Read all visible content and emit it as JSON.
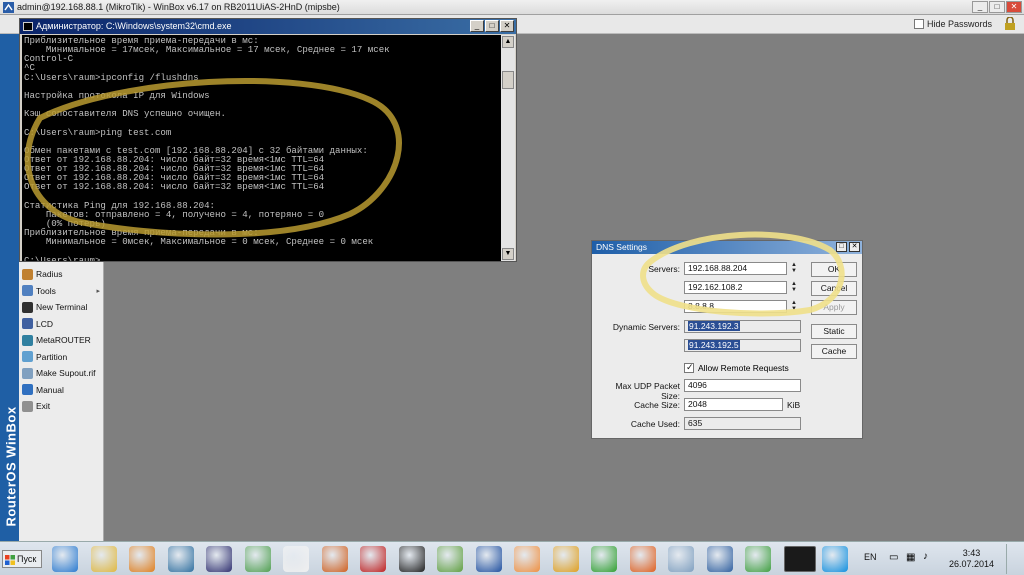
{
  "winbox": {
    "title": "admin@192.168.88.1 (MikroTik) - WinBox v6.17 on RB2011UiAS-2HnD (mipsbe)",
    "hide_passwords_label": "Hide Passwords",
    "hide_passwords_checked": false,
    "sidebar_brand": "RouterOS WinBox",
    "menu": [
      {
        "label": "Radius",
        "icon": "radius-icon",
        "color": "#c08030"
      },
      {
        "label": "Tools",
        "icon": "tools-icon",
        "color": "#5080c0",
        "submenu": true
      },
      {
        "label": "New Terminal",
        "icon": "terminal-icon",
        "color": "#303030"
      },
      {
        "label": "LCD",
        "icon": "lcd-icon",
        "color": "#4060a0"
      },
      {
        "label": "MetaROUTER",
        "icon": "metarouter-icon",
        "color": "#3080a0"
      },
      {
        "label": "Partition",
        "icon": "partition-icon",
        "color": "#60a0d0"
      },
      {
        "label": "Make Supout.rif",
        "icon": "supout-icon",
        "color": "#80a0c0"
      },
      {
        "label": "Manual",
        "icon": "manual-icon",
        "color": "#3070c0"
      },
      {
        "label": "Exit",
        "icon": "exit-icon",
        "color": "#909090"
      }
    ]
  },
  "cmd": {
    "title": "Администратор: C:\\Windows\\system32\\cmd.exe",
    "lines": [
      "Приблизительное время приема-передачи в мс:",
      "    Минимальное = 17мсек, Максимальное = 17 мсек, Среднее = 17 мсек",
      "Control-C",
      "^C",
      "C:\\Users\\raum>ipconfig /flushdns",
      "",
      "Настройка протокола IP для Windows",
      "",
      "Кэш сопоставителя DNS успешно очищен.",
      "",
      "C:\\Users\\raum>ping test.com",
      "",
      "Обмен пакетами с test.com [192.168.88.204] с 32 байтами данных:",
      "Ответ от 192.168.88.204: число байт=32 время<1мс TTL=64",
      "Ответ от 192.168.88.204: число байт=32 время<1мс TTL=64",
      "Ответ от 192.168.88.204: число байт=32 время<1мс TTL=64",
      "Ответ от 192.168.88.204: число байт=32 время<1мс TTL=64",
      "",
      "Статистика Ping для 192.168.88.204:",
      "    Пакетов: отправлено = 4, получено = 4, потеряно = 0",
      "    (0% потерь)",
      "Приблизительное время приема-передачи в мс:",
      "    Минимальное = 0мсек, Максимальное = 0 мсек, Среднее = 0 мсек",
      "",
      "C:\\Users\\raum>_"
    ]
  },
  "dns": {
    "title": "DNS Settings",
    "servers_label": "Servers:",
    "servers": [
      "192.168.88.204",
      "192.162.108.2",
      "8.8.8.8"
    ],
    "dynamic_label": "Dynamic Servers:",
    "dynamic_servers": [
      "91.243.192.3",
      "91.243.192.5"
    ],
    "allow_remote_label": "Allow Remote Requests",
    "allow_remote_checked": true,
    "max_udp_label": "Max UDP Packet Size:",
    "max_udp_value": "4096",
    "cache_size_label": "Cache Size:",
    "cache_size_value": "2048",
    "cache_size_unit": "KiB",
    "cache_used_label": "Cache Used:",
    "cache_used_value": "635",
    "buttons": {
      "ok": "OK",
      "cancel": "Cancel",
      "apply": "Apply",
      "static": "Static",
      "cache": "Cache"
    }
  },
  "taskbar": {
    "start_label": "Пуск",
    "language": "EN",
    "time": "3:43",
    "date": "26.07.2014",
    "apps": [
      {
        "name": "ie-icon",
        "color": "#2a7ad0"
      },
      {
        "name": "explorer-icon",
        "color": "#e0b840"
      },
      {
        "name": "media-player-icon",
        "color": "#e08020"
      },
      {
        "name": "browser-globe-icon",
        "color": "#3070a0"
      },
      {
        "name": "floppy-icon",
        "color": "#303070"
      },
      {
        "name": "remote-desktop-icon",
        "color": "#50a050"
      },
      {
        "name": "soccer-ball-icon",
        "color": "#f0f0f0"
      },
      {
        "name": "eye-app-icon",
        "color": "#d06020"
      },
      {
        "name": "installer-icon",
        "color": "#c02020"
      },
      {
        "name": "record-icon",
        "color": "#202020"
      },
      {
        "name": "notepad-icon",
        "color": "#60a040"
      },
      {
        "name": "app-circle-icon",
        "color": "#2050a0"
      },
      {
        "name": "half-circle-icon",
        "color": "#f09040"
      },
      {
        "name": "virtualbox-window-icon",
        "color": "#e0a020"
      },
      {
        "name": "triangle-app-icon",
        "color": "#30a030"
      },
      {
        "name": "firefox-icon",
        "color": "#e06020"
      },
      {
        "name": "eye-icon",
        "color": "#80a0c0"
      },
      {
        "name": "virtualbox-icon",
        "color": "#3060a0"
      },
      {
        "name": "utorrent-icon",
        "color": "#40a040"
      },
      {
        "name": "cmd-icon",
        "color": "#101010"
      },
      {
        "name": "skype-icon",
        "color": "#1090e0"
      }
    ]
  }
}
